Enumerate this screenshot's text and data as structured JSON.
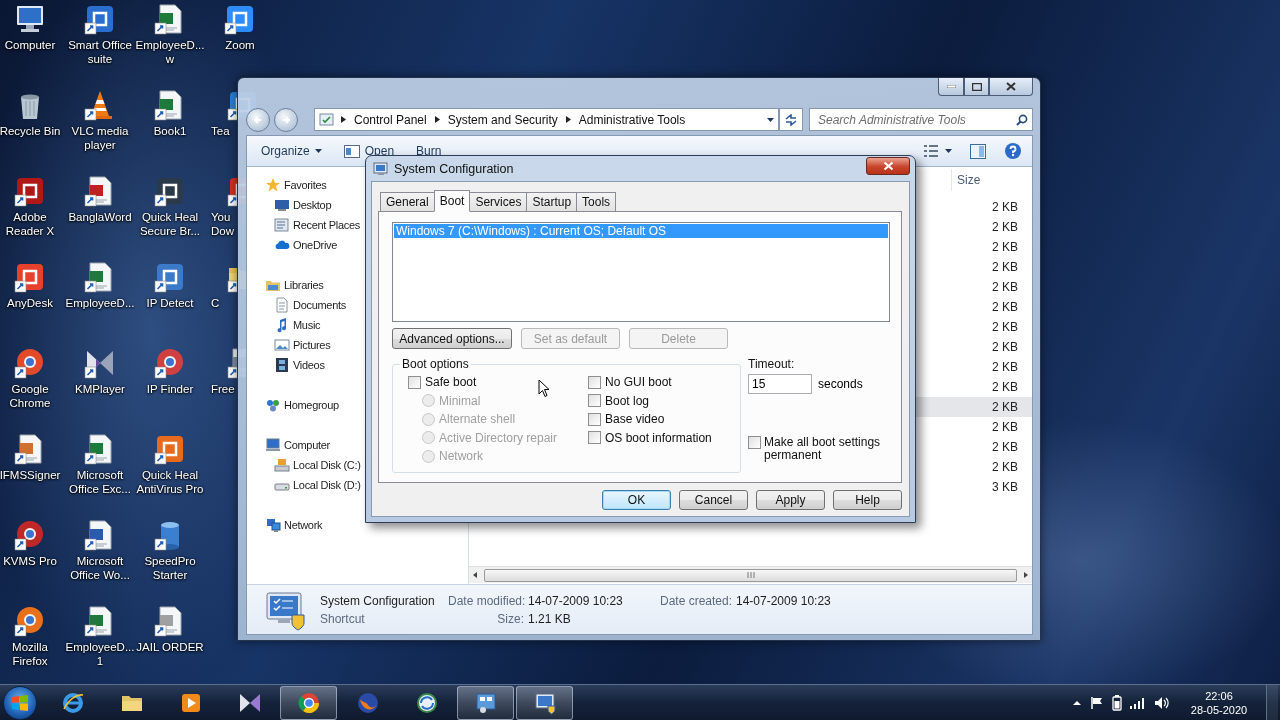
{
  "desktop": {
    "rows": [
      [
        {
          "lines": [
            "Computer"
          ]
        },
        {
          "lines": [
            "Smart Office",
            "suite"
          ]
        },
        {
          "lines": [
            "EmployeeD...",
            "w"
          ]
        },
        {
          "lines": [
            "Zoom"
          ]
        }
      ],
      [
        {
          "lines": [
            "Recycle Bin"
          ]
        },
        {
          "lines": [
            "VLC media",
            "player"
          ]
        },
        {
          "lines": [
            "Book1"
          ]
        },
        {
          "lines": [
            "Tea"
          ]
        }
      ],
      [
        {
          "lines": [
            "Adobe",
            "Reader X"
          ]
        },
        {
          "lines": [
            "BanglaWord"
          ]
        },
        {
          "lines": [
            "Quick Heal",
            "Secure Br..."
          ]
        },
        {
          "lines": [
            "You",
            "Dow"
          ]
        }
      ],
      [
        {
          "lines": [
            "AnyDesk"
          ]
        },
        {
          "lines": [
            "EmployeeD..."
          ]
        },
        {
          "lines": [
            "IP Detect"
          ]
        },
        {
          "lines": [
            "C"
          ]
        }
      ],
      [
        {
          "lines": [
            "Google",
            "Chrome"
          ]
        },
        {
          "lines": [
            "KMPlayer"
          ]
        },
        {
          "lines": [
            "IP Finder"
          ]
        },
        {
          "lines": [
            "Free"
          ]
        }
      ],
      [
        {
          "lines": [
            "IFMSSigner"
          ]
        },
        {
          "lines": [
            "Microsoft",
            "Office Exc..."
          ]
        },
        {
          "lines": [
            "Quick Heal",
            "AntiVirus Pro"
          ]
        }
      ],
      [
        {
          "lines": [
            "KVMS Pro"
          ]
        },
        {
          "lines": [
            "Microsoft",
            "Office Wo..."
          ]
        },
        {
          "lines": [
            "SpeedPro",
            "Starter"
          ]
        }
      ],
      [
        {
          "lines": [
            "Mozilla",
            "Firefox"
          ]
        },
        {
          "lines": [
            "EmployeeD...",
            "1"
          ]
        },
        {
          "lines": [
            "JAIL ORDER"
          ]
        }
      ]
    ]
  },
  "explorer": {
    "breadcrumb": [
      "Control Panel",
      "System and Security",
      "Administrative Tools"
    ],
    "search": {
      "placeholder": "Search Administrative Tools"
    },
    "toolbar": [
      {
        "label": "Organize",
        "menu": true
      },
      {
        "label": "Open",
        "menu": false
      },
      {
        "label": "Burn",
        "menu": false
      }
    ],
    "navigation": [
      {
        "label": "Favorites",
        "children": [
          {
            "label": "Desktop"
          },
          {
            "label": "Recent Places"
          },
          {
            "label": "OneDrive"
          }
        ]
      },
      {
        "label": "Libraries",
        "children": [
          {
            "label": "Documents"
          },
          {
            "label": "Music"
          },
          {
            "label": "Pictures"
          },
          {
            "label": "Videos"
          }
        ]
      },
      {
        "label": "Homegroup"
      },
      {
        "label": "Computer",
        "children": [
          {
            "label": "Local Disk (C:)"
          },
          {
            "label": "Local Disk (D:)"
          }
        ]
      },
      {
        "label": "Network"
      }
    ],
    "file_list": {
      "columns": [
        "Size"
      ],
      "rows": [
        {
          "size": "2 KB",
          "selected": false
        },
        {
          "size": "2 KB",
          "selected": false
        },
        {
          "size": "2 KB",
          "selected": false
        },
        {
          "size": "2 KB",
          "selected": false
        },
        {
          "size": "2 KB",
          "selected": false
        },
        {
          "size": "2 KB",
          "selected": false
        },
        {
          "size": "2 KB",
          "selected": false
        },
        {
          "size": "2 KB",
          "selected": false
        },
        {
          "size": "2 KB",
          "selected": false
        },
        {
          "size": "2 KB",
          "selected": false
        },
        {
          "size": "2 KB",
          "selected": true
        },
        {
          "size": "2 KB",
          "selected": false
        },
        {
          "size": "2 KB",
          "selected": false
        },
        {
          "size": "2 KB",
          "selected": false
        },
        {
          "size": "3 KB",
          "selected": false
        }
      ]
    },
    "details": {
      "name": "System Configuration",
      "type": "Shortcut",
      "fields": [
        {
          "label": "Date modified:",
          "value": "14-07-2009 10:23"
        },
        {
          "label": "Date created:",
          "value": "14-07-2009 10:23"
        },
        {
          "label": "Size:",
          "value": "1.21 KB"
        }
      ]
    }
  },
  "dialog": {
    "title": "System Configuration",
    "tabs": [
      {
        "label": "General",
        "selected": false
      },
      {
        "label": "Boot",
        "selected": true
      },
      {
        "label": "Services",
        "selected": false
      },
      {
        "label": "Startup",
        "selected": false
      },
      {
        "label": "Tools",
        "selected": false
      }
    ],
    "os_list": [
      {
        "label": "Windows 7 (C:\\Windows) : Current OS; Default OS",
        "selected": true
      }
    ],
    "list_buttons": [
      {
        "label": "Advanced options...",
        "disabled": false
      },
      {
        "label": "Set as default",
        "disabled": true
      },
      {
        "label": "Delete",
        "disabled": true
      }
    ],
    "boot_options": {
      "title": "Boot options",
      "safe_boot": {
        "label": "Safe boot",
        "checked": false
      },
      "safe_modes": [
        {
          "label": "Minimal",
          "selected": false,
          "disabled": true
        },
        {
          "label": "Alternate shell",
          "selected": false,
          "disabled": true
        },
        {
          "label": "Active Directory repair",
          "selected": false,
          "disabled": true
        },
        {
          "label": "Network",
          "selected": false,
          "disabled": true
        }
      ],
      "flags": [
        {
          "label": "No GUI boot",
          "checked": false
        },
        {
          "label": "Boot log",
          "checked": false
        },
        {
          "label": "Base video",
          "checked": false
        },
        {
          "label": "OS boot information",
          "checked": false
        }
      ]
    },
    "timeout": {
      "label": "Timeout:",
      "value": "15",
      "unit": "seconds"
    },
    "permanent": {
      "label": "Make all boot settings permanent",
      "checked": false
    },
    "buttons": [
      {
        "label": "OK",
        "default": true
      },
      {
        "label": "Cancel",
        "default": false
      },
      {
        "label": "Apply",
        "default": false
      },
      {
        "label": "Help",
        "default": false
      }
    ]
  },
  "taskbar": {
    "items": [
      {
        "active": false
      },
      {
        "active": false
      },
      {
        "active": false
      },
      {
        "active": false
      },
      {
        "active": true
      },
      {
        "active": false
      },
      {
        "active": false
      },
      {
        "active": true
      },
      {
        "active": true
      }
    ],
    "clock": {
      "time": "22:06",
      "date": "28-05-2020"
    }
  }
}
